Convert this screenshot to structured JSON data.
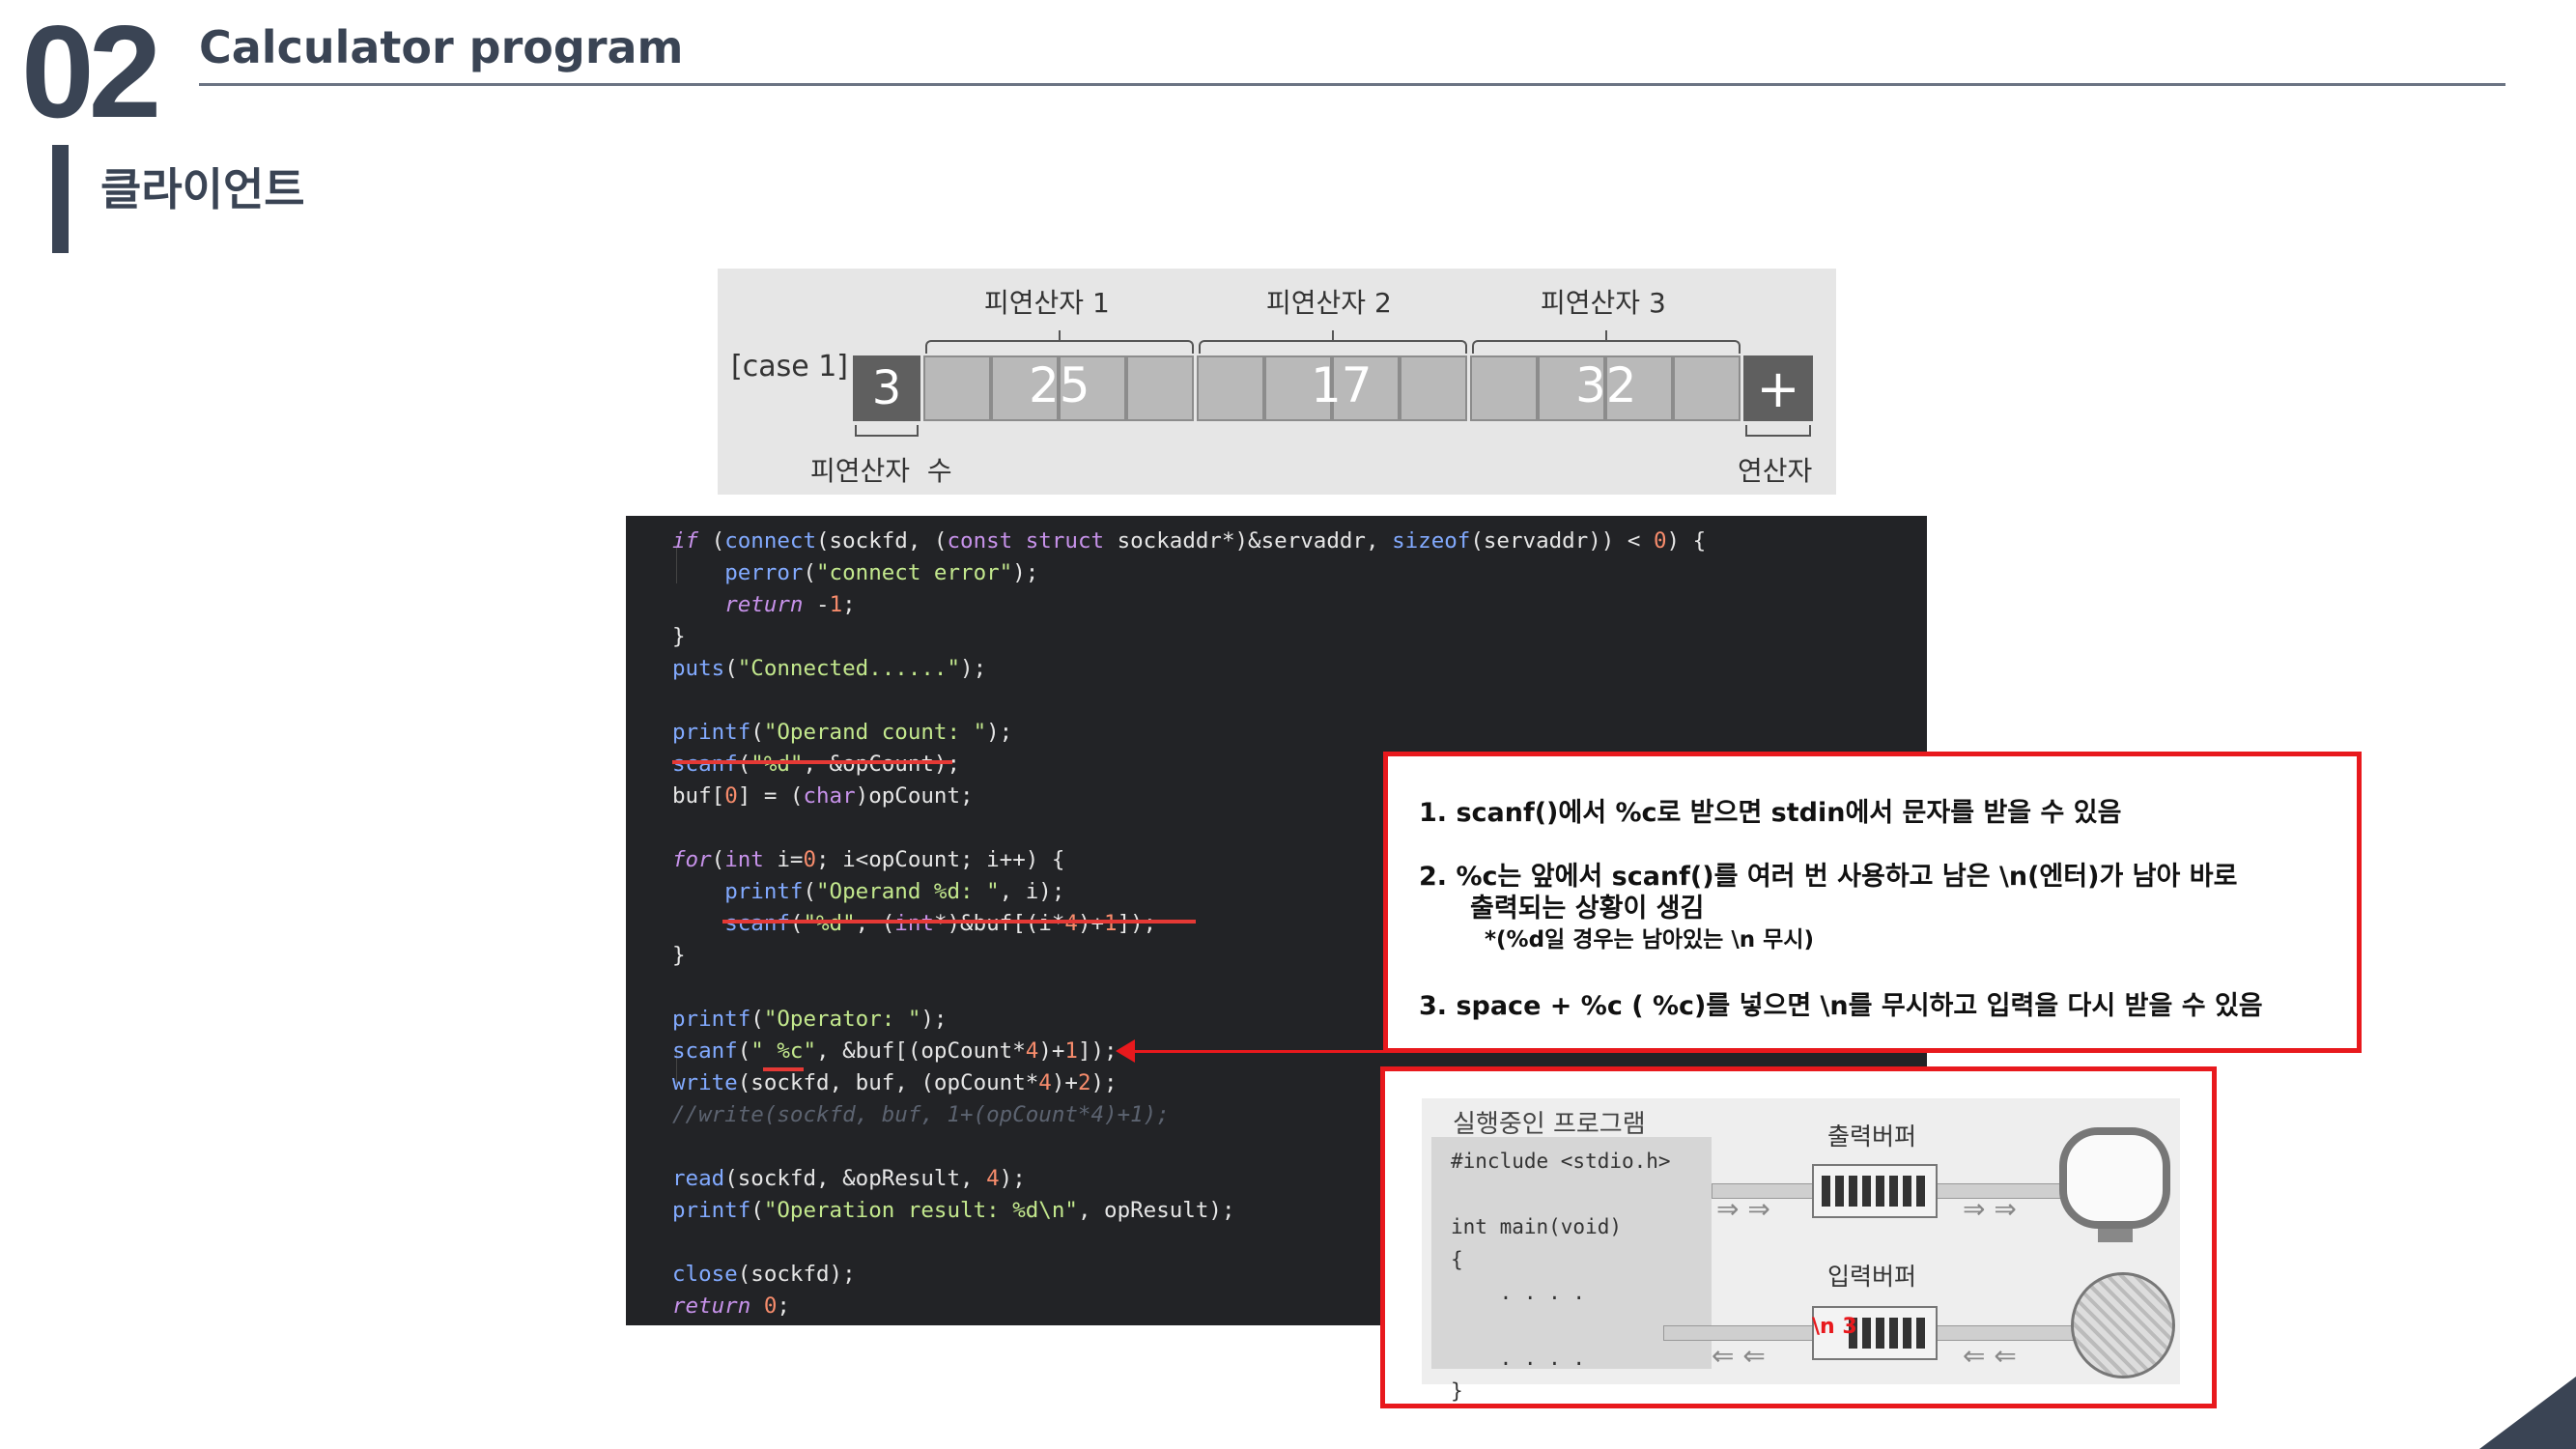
{
  "header": {
    "number": "02",
    "title": "Calculator program",
    "subtitle": "클라이언트"
  },
  "case_diagram": {
    "case_label": "[case 1]",
    "operand_count_value": "3",
    "operand_labels": [
      "피연산자 1",
      "피연산자 2",
      "피연산자 3"
    ],
    "operand_values": [
      "25",
      "17",
      "32"
    ],
    "operator_value": "+",
    "operand_count_label": "피연산자  수",
    "operator_label": "연산자"
  },
  "code": {
    "lines": [
      "if (connect(sockfd, (const struct sockaddr*)&servaddr, sizeof(servaddr)) < 0) {",
      "    perror(\"connect error\");",
      "    return -1;",
      "}",
      "puts(\"Connected......\");",
      "",
      "printf(\"Operand count: \");",
      "scanf(\"%d\", &opCount);",
      "buf[0] = (char)opCount;",
      "",
      "for(int i=0; i<opCount; i++) {",
      "    printf(\"Operand %d: \", i);",
      "    scanf(\"%d\", (int*)&buf[(i*4)+1]);",
      "}",
      "",
      "printf(\"Operator: \");",
      "scanf(\" %c\", &buf[(opCount*4)+1]);",
      "write(sockfd, buf, (opCount*4)+2);",
      "//write(sockfd, buf, 1+(opCount*4)+1);",
      "",
      "read(sockfd, &opResult, 4);",
      "printf(\"Operation result: %d\\n\", opResult);",
      "",
      "close(sockfd);",
      "return 0;"
    ]
  },
  "notes": {
    "item1": "1.   scanf()에서 %c로 받으면 stdin에서 문자를 받을 수 있음",
    "item2a": "2.   %c는 앞에서 scanf()를 여러 번 사용하고 남은 \\n(엔터)가 남아 바로",
    "item2b": "출력되는 상황이 생김",
    "item2c": "*(%d일 경우는 남아있는 \\n 무시)",
    "item3": "3.   space + %c (  %c)를 넣으면 \\n를 무시하고 입력을 다시 받을 수 있음"
  },
  "buffer_diagram": {
    "program_label": "실행중인 프로그램",
    "program_code": "#include <stdio.h>\n\nint main(void)\n{\n    . . . .\n\n    . . . .\n}",
    "output_buffer_label": "출력버퍼",
    "input_buffer_label": "입력버퍼",
    "input_buffer_annotation": "\\n 3"
  },
  "colors": {
    "accent_dark": "#3a4454",
    "highlight_red": "#e8191d"
  }
}
